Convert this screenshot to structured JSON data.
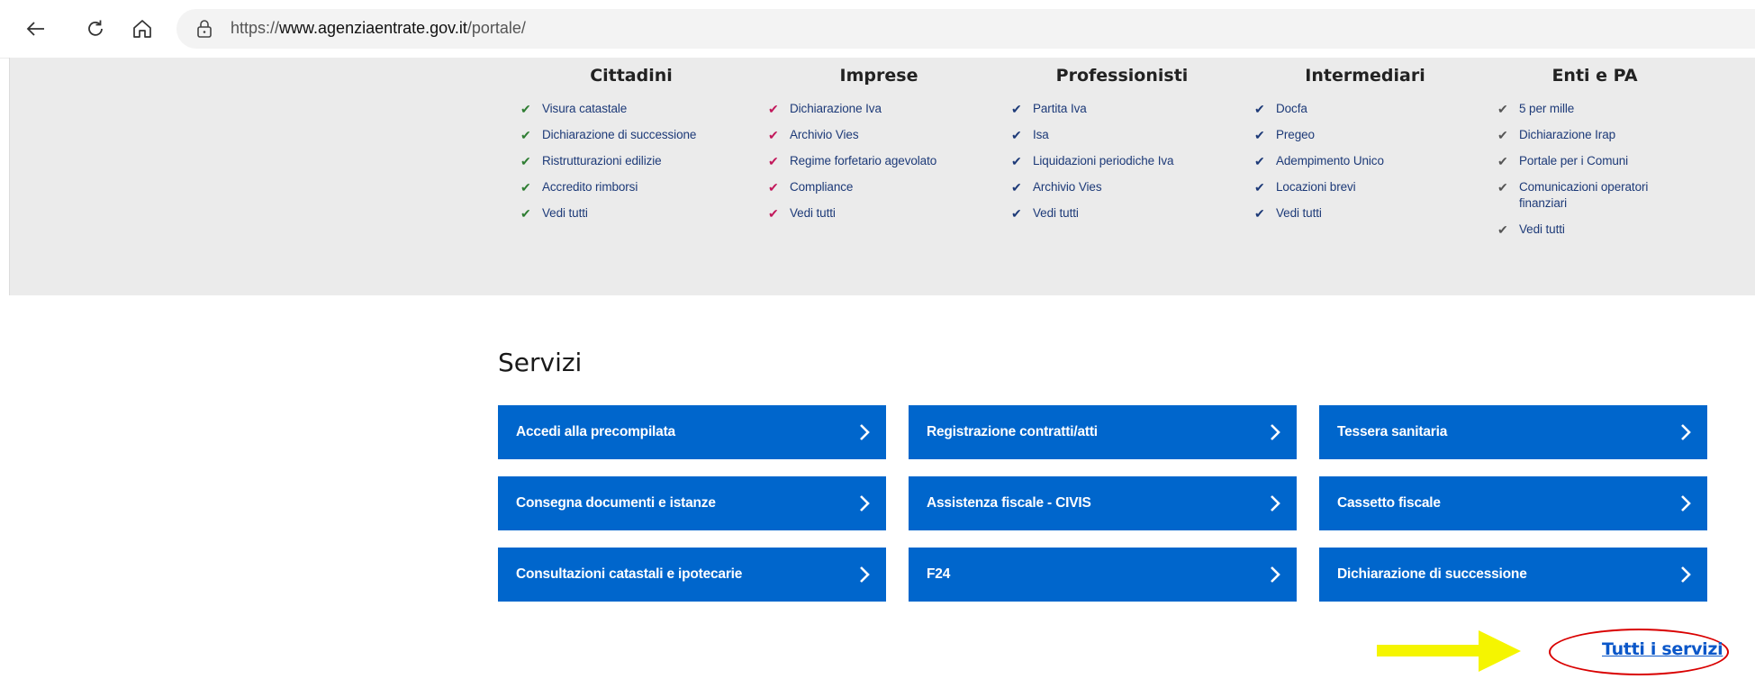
{
  "browser": {
    "url_prefix": "https://",
    "url_domain": "www.agenziaentrate.gov.it",
    "url_path": "/portale/"
  },
  "menu": {
    "columns": [
      {
        "title": "Cittadini",
        "check_color": "#2e7d32",
        "items": [
          "Visura catastale",
          "Dichiarazione di successione",
          "Ristrutturazioni edilizie",
          "Accredito rimborsi",
          "Vedi tutti"
        ]
      },
      {
        "title": "Imprese",
        "check_color": "#c2185b",
        "items": [
          "Dichiarazione Iva",
          "Archivio Vies",
          "Regime forfetario agevolato",
          "Compliance",
          "Vedi tutti"
        ]
      },
      {
        "title": "Professionisti",
        "check_color": "#1d3a78",
        "items": [
          "Partita Iva",
          "Isa",
          "Liquidazioni periodiche Iva",
          "Archivio Vies",
          "Vedi tutti"
        ]
      },
      {
        "title": "Intermediari",
        "check_color": "#1d3a78",
        "items": [
          "Docfa",
          "Pregeo",
          "Adempimento Unico",
          "Locazioni brevi",
          "Vedi tutti"
        ]
      },
      {
        "title": "Enti e PA",
        "check_color": "#555555",
        "items": [
          "5 per mille",
          "Dichiarazione Irap",
          "Portale per i Comuni",
          "Comunicazioni operatori finanziari",
          "Vedi tutti"
        ]
      }
    ]
  },
  "servizi": {
    "title": "Servizi",
    "buttons": [
      "Accedi alla precompilata",
      "Registrazione contratti/atti",
      "Tessera sanitaria",
      "Consegna documenti e istanze",
      "Assistenza fiscale - CIVIS",
      "Cassetto fiscale",
      "Consultazioni catastali e ipotecarie",
      "F24",
      "Dichiarazione di successione"
    ],
    "all_link": "Tutti i servizi"
  },
  "colors": {
    "service_blue": "#0066cc",
    "menu_bg": "#ebebeb",
    "annotation_red": "#d90000",
    "annotation_yellow": "#f5f500"
  }
}
